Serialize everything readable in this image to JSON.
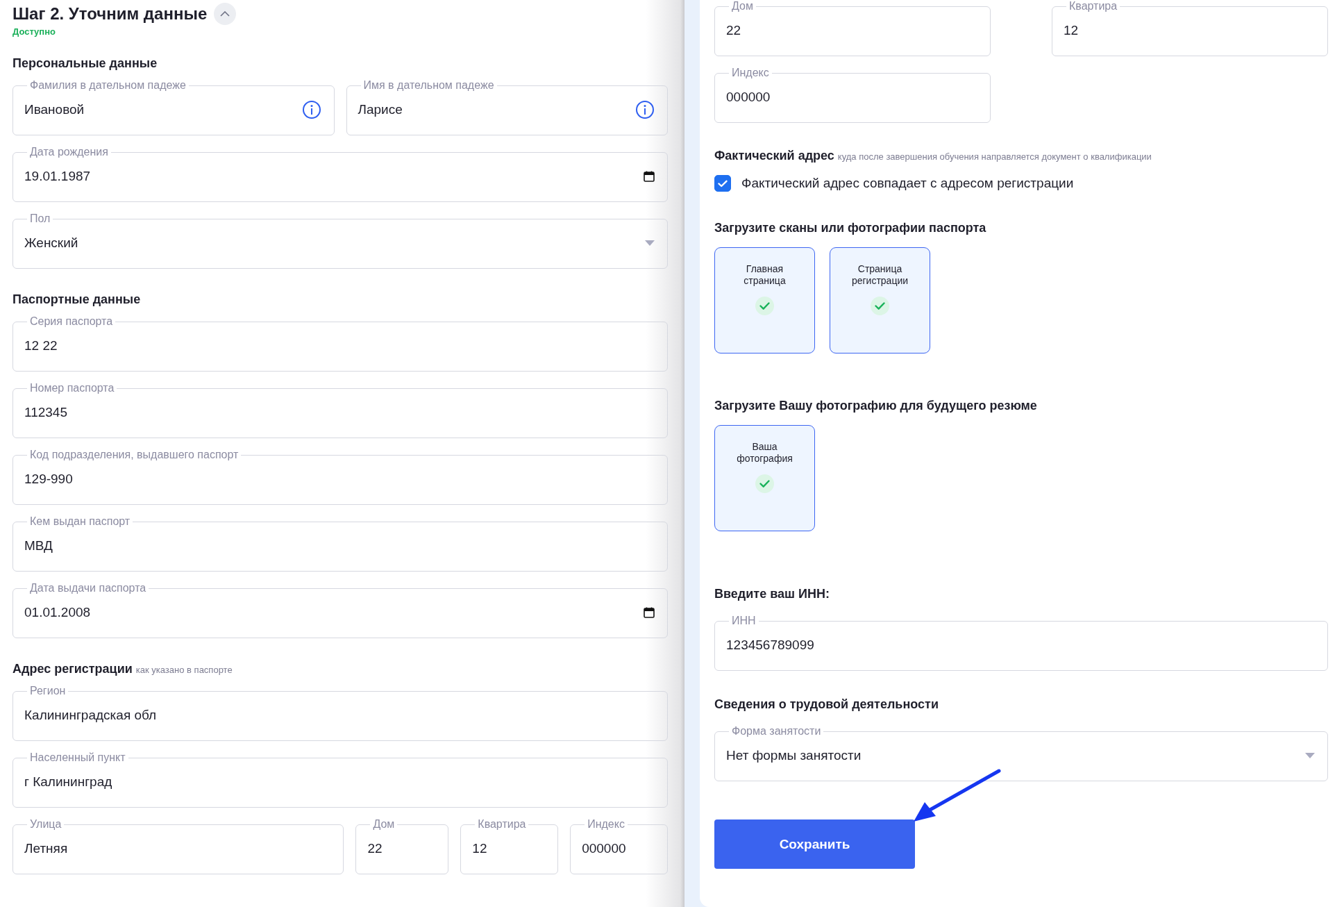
{
  "left": {
    "step": {
      "title": "Шаг 2. Уточним данные",
      "status": "Доступно"
    },
    "sections": [
      {
        "heading": "Персональные данные",
        "rows": [
          [
            {
              "kind": "text_info",
              "label": "Фамилия в дательном падеже",
              "value": "Ивановой"
            },
            {
              "kind": "text_info",
              "label": "Имя в дательном падеже",
              "value": "Ларисе"
            }
          ],
          [
            {
              "kind": "date",
              "label": "Дата рождения",
              "value": "19.01.1987"
            }
          ],
          [
            {
              "kind": "select",
              "label": "Пол",
              "value": "Женский"
            }
          ]
        ]
      },
      {
        "heading": "Паспортные данные",
        "rows": [
          [
            {
              "kind": "text",
              "label": "Серия паспорта",
              "value": "12 22"
            }
          ],
          [
            {
              "kind": "text",
              "label": "Номер паспорта",
              "value": "112345"
            }
          ],
          [
            {
              "kind": "text",
              "label": "Код подразделения, выдавшего паспорт",
              "value": "129-990"
            }
          ],
          [
            {
              "kind": "text",
              "label": "Кем выдан паспорт",
              "value": "МВД"
            }
          ],
          [
            {
              "kind": "date",
              "label": "Дата выдачи паспорта",
              "value": "01.01.2008"
            }
          ]
        ]
      },
      {
        "heading": "Адрес регистрации",
        "note": "как указано в паспорте",
        "rows": [
          [
            {
              "kind": "text",
              "label": "Регион",
              "value": "Калининградская обл"
            }
          ],
          [
            {
              "kind": "text",
              "label": "Населенный пункт",
              "value": "г Калининград"
            }
          ],
          [
            {
              "kind": "text",
              "label": "Улица",
              "value": "Летняя"
            },
            {
              "kind": "text",
              "label": "Дом",
              "value": "22"
            },
            {
              "kind": "text",
              "label": "Квартира",
              "value": "12"
            },
            {
              "kind": "text",
              "label": "Индекс",
              "value": "000000"
            }
          ]
        ]
      }
    ]
  },
  "right": {
    "address_rows": [
      [
        {
          "kind": "text",
          "label": "Дом",
          "value": "22"
        },
        {
          "kind": "text",
          "label": "Квартира",
          "value": "12"
        }
      ],
      [
        {
          "kind": "text",
          "label": "Индекс",
          "value": "000000"
        }
      ]
    ],
    "actual_address": {
      "heading": "Фактический адрес",
      "note": "куда после завершения обучения направляется документ о квалификации",
      "checkbox": {
        "label": "Фактический адрес совпадает с адресом регистрации",
        "checked": true
      }
    },
    "passport_uploads": {
      "heading": "Загрузите сканы или фотографии паспорта",
      "cards": [
        {
          "label": "Главная страница",
          "uploaded": true
        },
        {
          "label": "Страница регистрации",
          "uploaded": true
        }
      ]
    },
    "photo_upload": {
      "heading": "Загрузите Вашу фотографию для будущего резюме",
      "cards": [
        {
          "label": "Ваша фотография",
          "uploaded": true
        }
      ]
    },
    "inn": {
      "heading": "Введите ваш ИНН:",
      "field": {
        "kind": "text",
        "label": "ИНН",
        "value": "123456789099"
      }
    },
    "employment": {
      "heading": "Сведения о трудовой деятельности",
      "field": {
        "kind": "select",
        "label": "Форма занятости",
        "value": "Нет формы занятости"
      }
    },
    "save_button": "Сохранить"
  }
}
